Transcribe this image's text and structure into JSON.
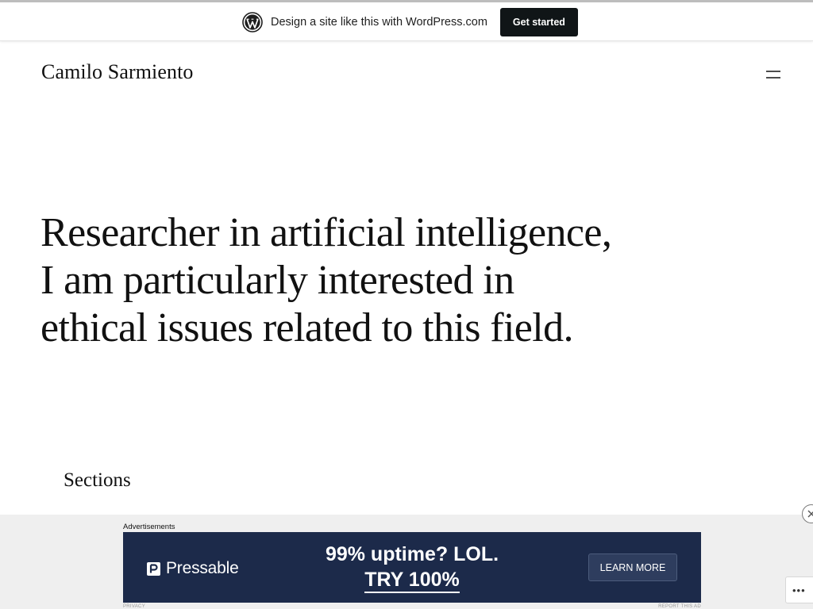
{
  "wp_bar": {
    "logo_icon": "wordpress-logo-icon",
    "text": "Design a site like this with WordPress.com",
    "cta_label": "Get started"
  },
  "site": {
    "title": "Camilo Sarmiento",
    "menu_icon": "hamburger-menu-icon"
  },
  "hero": {
    "lines": [
      "Researcher in artificial intelligence,",
      "I am particularly interested in",
      "ethical issues related to this field."
    ]
  },
  "sections": {
    "heading": "Sections"
  },
  "ad": {
    "label": "Advertisements",
    "brand": "Pressable",
    "headline_line1": "99% uptime? LOL.",
    "headline_line2": "TRY 100%",
    "cta_label": "LEARN MORE",
    "footer_left": "PRIVACY",
    "footer_right": "REPORT THIS AD",
    "close_icon": "close-icon",
    "more_icon": "ellipsis-icon",
    "more_label": "•••",
    "colors": {
      "banner_bg": "#1c2a4a",
      "cta_bg": "#2e3d5e"
    }
  },
  "colors": {
    "wp_cta_bg": "#101517",
    "text": "#111111",
    "background": "#ffffff",
    "ad_area_bg": "#efefef"
  }
}
